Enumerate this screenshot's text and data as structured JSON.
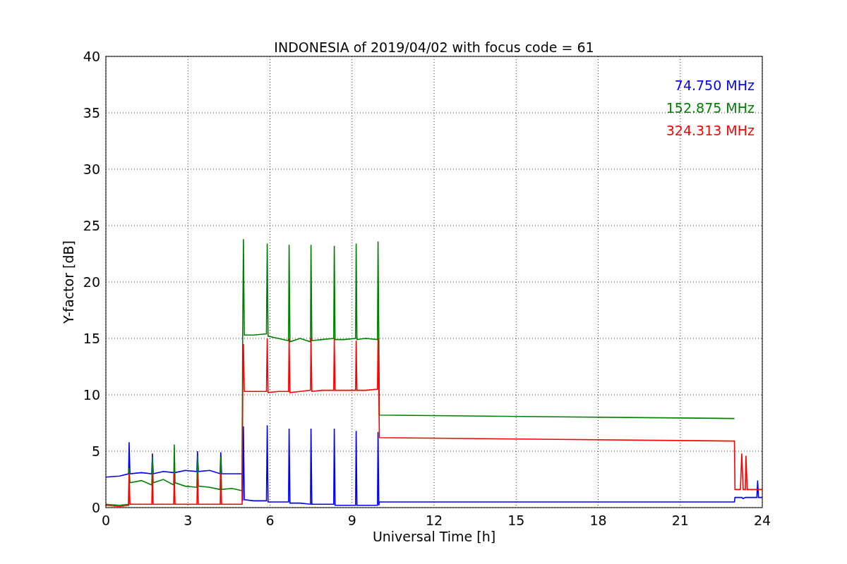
{
  "chart_data": {
    "type": "line",
    "title": "INDONESIA of 2019/04/02 with focus code = 61",
    "xlabel": "Universal Time [h]",
    "ylabel": "Y-factor [dB]",
    "xlim": [
      0,
      24
    ],
    "ylim": [
      0,
      40
    ],
    "xticks": [
      0,
      3,
      6,
      9,
      12,
      15,
      18,
      21,
      24
    ],
    "yticks": [
      0,
      5,
      10,
      15,
      20,
      25,
      30,
      35,
      40
    ],
    "grid": true,
    "x": [
      0,
      0.5,
      0.83,
      0.85,
      0.88,
      1.3,
      1.68,
      1.7,
      1.73,
      2.1,
      2.48,
      2.5,
      2.53,
      2.9,
      3.33,
      3.35,
      3.38,
      3.8,
      4.18,
      4.2,
      4.23,
      4.6,
      4.98,
      5.0,
      5.03,
      5.06,
      5.4,
      5.87,
      5.9,
      5.93,
      6.3,
      6.68,
      6.7,
      6.73,
      7.1,
      7.48,
      7.5,
      7.53,
      7.9,
      8.33,
      8.35,
      8.38,
      8.7,
      9.13,
      9.15,
      9.18,
      9.5,
      9.93,
      9.95,
      9.98,
      10.0,
      22.98,
      23.0,
      23.2,
      23.25,
      23.3,
      23.38,
      23.4,
      23.45,
      23.8,
      23.83,
      23.86,
      24
    ],
    "series": [
      {
        "name": "74.750 MHz",
        "color": "#0000ff",
        "values": [
          2.7,
          2.8,
          3.0,
          5.8,
          3.0,
          3.1,
          3.0,
          4.8,
          3.0,
          3.2,
          3.1,
          3.1,
          3.1,
          3.3,
          3.2,
          5.0,
          3.2,
          3.3,
          3.0,
          4.9,
          3.0,
          3.0,
          3.0,
          0.6,
          7.2,
          0.7,
          0.6,
          0.6,
          7.3,
          0.5,
          0.5,
          0.5,
          7.0,
          0.4,
          0.4,
          0.3,
          7.0,
          0.3,
          0.3,
          0.3,
          7.0,
          0.2,
          0.2,
          0.2,
          6.8,
          0.2,
          0.2,
          0.2,
          6.7,
          0.2,
          0.5,
          0.5,
          0.9,
          0.9,
          0.9,
          0.8,
          0.9,
          0.9,
          0.9,
          0.9,
          2.4,
          0.9,
          0.9
        ]
      },
      {
        "name": "152.875 MHz",
        "color": "#008000",
        "values": [
          0.3,
          0.2,
          0.3,
          3.5,
          2.2,
          2.4,
          2.0,
          4.5,
          2.2,
          2.5,
          2.0,
          5.6,
          2.2,
          1.9,
          1.8,
          4.6,
          1.9,
          1.8,
          1.6,
          4.5,
          1.6,
          1.7,
          1.5,
          15.3,
          23.8,
          15.3,
          15.3,
          15.4,
          23.4,
          15.2,
          15.0,
          14.8,
          23.3,
          14.7,
          15.0,
          14.7,
          23.3,
          14.8,
          14.9,
          15.0,
          23.2,
          14.9,
          14.9,
          15.0,
          23.4,
          14.9,
          15.0,
          14.9,
          23.6,
          15.0,
          8.2,
          7.9,
          null,
          null,
          null,
          null,
          null,
          null,
          null,
          null,
          null,
          null,
          null
        ]
      },
      {
        "name": "324.313 MHz",
        "color": "#ff0000",
        "values": [
          0.2,
          0.1,
          0.2,
          3.0,
          0.3,
          0.3,
          0.3,
          3.0,
          0.3,
          0.3,
          0.3,
          3.0,
          0.3,
          0.3,
          0.3,
          3.0,
          0.3,
          0.3,
          0.3,
          3.0,
          0.3,
          0.3,
          0.3,
          10.3,
          14.5,
          10.3,
          10.3,
          10.3,
          15.0,
          10.2,
          10.3,
          10.3,
          15.0,
          10.2,
          10.3,
          10.4,
          15.0,
          10.3,
          10.4,
          10.4,
          15.0,
          10.4,
          10.4,
          10.4,
          14.8,
          10.4,
          10.4,
          10.5,
          15.0,
          10.4,
          6.2,
          5.9,
          1.6,
          1.6,
          4.8,
          1.6,
          1.6,
          4.6,
          1.6,
          1.6,
          1.6,
          1.6,
          1.6
        ]
      }
    ]
  }
}
